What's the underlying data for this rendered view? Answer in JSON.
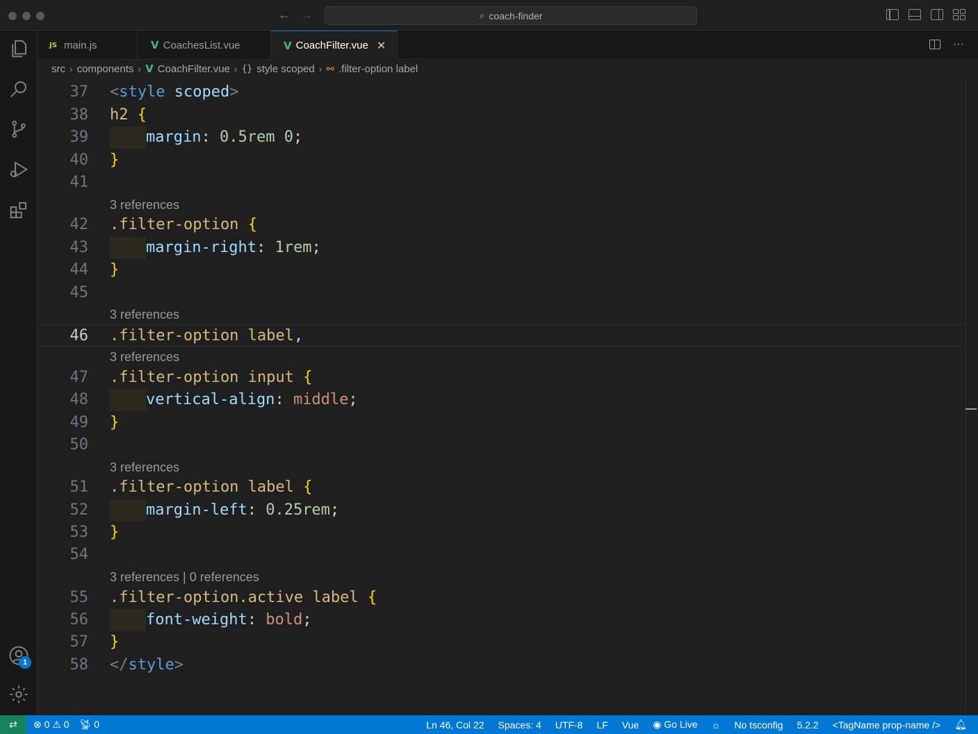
{
  "window": {
    "title": "coach-finder"
  },
  "tabs": [
    {
      "label": "main.js",
      "icon": "js-icon",
      "active": false
    },
    {
      "label": "CoachesList.vue",
      "icon": "vue-icon",
      "active": false
    },
    {
      "label": "CoachFilter.vue",
      "icon": "vue-icon",
      "active": true
    }
  ],
  "breadcrumb": {
    "folder1": "src",
    "folder2": "components",
    "file": "CoachFilter.vue",
    "section": "style scoped",
    "symbol": ".filter-option label"
  },
  "editor": {
    "lines": {
      "l37": "37",
      "l38": "38",
      "l39": "39",
      "l40": "40",
      "l41": "41",
      "l42": "42",
      "l43": "43",
      "l44": "44",
      "l45": "45",
      "l46": "46",
      "l47": "47",
      "l48": "48",
      "l49": "49",
      "l50": "50",
      "l51": "51",
      "l52": "52",
      "l53": "53",
      "l54": "54",
      "l55": "55",
      "l56": "56",
      "l57": "57",
      "l58": "58"
    },
    "lens": {
      "l42": "3 references",
      "l46": "3 references",
      "l47": "3 references",
      "l51": "3 references",
      "l55": "3 references | 0 references"
    },
    "current_line": 46
  },
  "status": {
    "errors": "0",
    "warnings": "0",
    "ports": "0",
    "position": "Ln 46, Col 22",
    "spaces": "Spaces: 4",
    "encoding": "UTF-8",
    "eol": "LF",
    "language": "Vue",
    "go_live": "Go Live",
    "tsconfig": "No tsconfig",
    "version": "5.2.2",
    "snippet": "<TagName prop-name />"
  },
  "accounts_badge": "1",
  "colors": {
    "statusbar": "#0078d4",
    "remote": "#16825d",
    "selector": "#d7ba7d",
    "property": "#9cdcfe",
    "brace": "#ffd700"
  }
}
